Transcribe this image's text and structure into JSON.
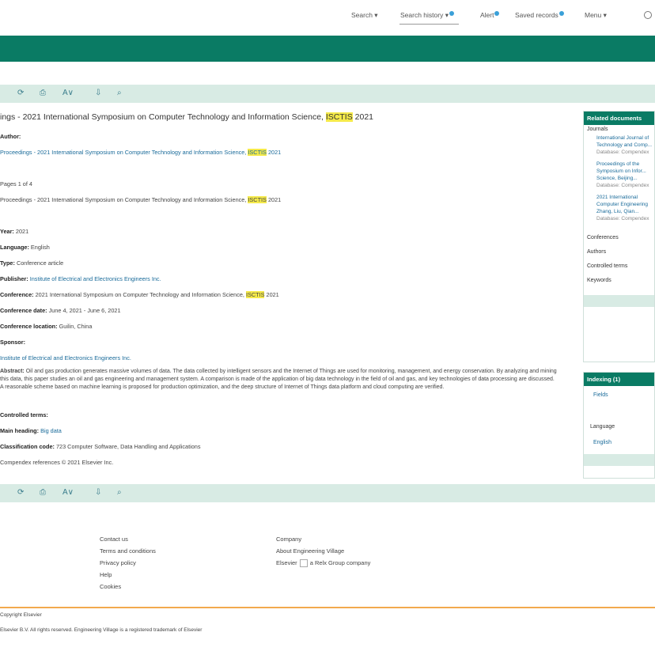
{
  "topnav": {
    "items": [
      {
        "label": "Search"
      },
      {
        "label": "Search history"
      },
      {
        "label": "Alert"
      },
      {
        "label": "Saved records"
      },
      {
        "label": "Menu"
      }
    ]
  },
  "toolbar_icons": [
    "refresh-icon",
    "print-icon",
    "font-size-icon",
    "export-icon",
    "search-icon"
  ],
  "title": {
    "prefix": "ings - 2021 International Symposium on Computer Technology and Information Science, ",
    "highlight": "ISCTIS",
    "suffix": " 2021"
  },
  "record": {
    "author_label": "Author:",
    "source_prefix": "Proceedings - 2021 International Symposium on Computer Technology and Information Science, ",
    "source_hl": "ISCTIS",
    "source_suffix": " 2021",
    "pages": "Pages 1 of 4",
    "vol_text": "Proceedings - 2021 International Symposium on Computer Technology and Information Science, ",
    "vol_hl": "ISCTIS",
    "vol_suffix": " 2021",
    "year_label": "Year:",
    "year_value": "2021",
    "language_label": "Language:",
    "language_value": "English",
    "doctype_label": "Type:",
    "doctype_value": "Conference article",
    "publisher_label": "Publisher:",
    "publisher_value": "Institute of Electrical and Electronics Engineers Inc.",
    "conf_label": "Conference:",
    "conf_prefix": "2021 International Symposium on Computer Technology and Information Science, ",
    "conf_hl": "ISCTIS",
    "conf_suffix": " 2021",
    "date_label": "Conference date:",
    "date_value": "June 4, 2021 - June 6, 2021",
    "location_label": "Conference location:",
    "location_value": "Guilin, China",
    "sponsor_label": "Sponsor:",
    "sponsor_value": "Institute of Electrical and Electronics Engineers Inc.",
    "abstract_label": "Abstract:",
    "abstract_text": "Oil and gas production generates massive volumes of data. The data collected by intelligent sensors and the Internet of Things are used for monitoring, management, and energy conservation. By analyzing and mining this data, this paper studies an oil and gas engineering and management system. A comparison is made of the application of big data technology in the field of oil and gas, and key technologies of data processing are discussed. A reasonable scheme based on machine learning is proposed for production optimization, and the deep structure of Internet of Things data platform and cloud computing are verified.",
    "controlled_label": "Controlled terms:",
    "main_label": "Main heading:",
    "main_value": "Big data",
    "class_label": "Classification code:",
    "class_value": "723 Computer Software, Data Handling and Applications",
    "copyright": "Compendex references © 2021 Elsevier Inc."
  },
  "sidebar": {
    "related_head": "Related documents",
    "journals_label": "Journals",
    "journal_lines": [
      "International Journal of",
      "Technology and Comp...",
      "Database: Compendex",
      "Proceedings of the",
      "Symposium on Infor...",
      "Science, Beijing...",
      "Database: Compendex",
      "2021 International",
      "Computer Engineering",
      "Zhang, Liu, Qian...",
      "Database: Compendex"
    ],
    "conferences_label": "Conferences",
    "authors_label": "Authors",
    "controlled_label": "Controlled terms",
    "keywords_label": "Keywords",
    "indexing_head": "Indexing (1)",
    "indexing_item": "Fields",
    "language_label": "Language",
    "language_item": "English"
  },
  "footer": {
    "col1": [
      "Contact us",
      "Terms and conditions",
      "Privacy policy",
      "Help",
      "Cookies"
    ],
    "col2": [
      "Company",
      "About Engineering Village",
      "Elsevier"
    ],
    "elsevier_tail": "a Relx Group company",
    "bottom1": "Copyright Elsevier",
    "bottom2": "Elsevier B.V. All rights reserved. Engineering Village is a registered trademark of Elsevier"
  }
}
